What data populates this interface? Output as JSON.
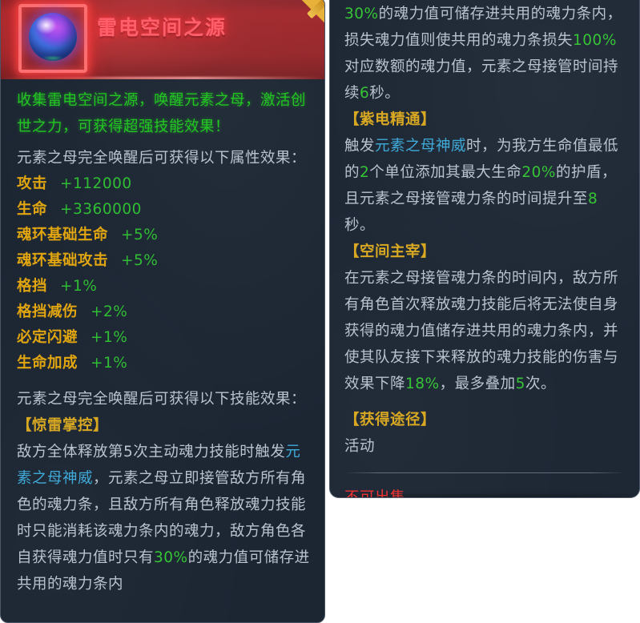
{
  "item": {
    "name": "雷电空间之源",
    "icon": "elemental-orb-icon",
    "rarity_color": "#ff5f6a",
    "frame_color": "#ff6f6f"
  },
  "left_panel": {
    "intro": "收集雷电空间之源，唤醒元素之母，激活创世之力，可获得超强技能效果！",
    "attribute_header": "元素之母完全唤醒后可获得以下属性效果：",
    "attributes": [
      {
        "label": "攻击",
        "value": "+112000"
      },
      {
        "label": "生命",
        "value": "+3360000"
      },
      {
        "label": "魂环基础生命",
        "value": "+5%"
      },
      {
        "label": "魂环基础攻击",
        "value": "+5%"
      },
      {
        "label": "格挡",
        "value": "+1%"
      },
      {
        "label": "格挡减伤",
        "value": "+2%"
      },
      {
        "label": "必定闪避",
        "value": "+1%"
      },
      {
        "label": "生命加成",
        "value": "+1%"
      }
    ],
    "skill_header": "元素之母完全唤醒后可获得以下技能效果：",
    "skill_1": {
      "title": "【惊雷掌控】",
      "parts": [
        {
          "text": "敌方全体释放第",
          "style": "grey"
        },
        {
          "text": "5",
          "style": "grey"
        },
        {
          "text": "次主动魂力技能时触发",
          "style": "grey"
        },
        {
          "text": "元素之母神威",
          "style": "blue"
        },
        {
          "text": "，元素之母立即接管敌方所有角色的魂力条，且敌方所有角色释放魂力技能时只能消耗该魂力条内的魂力，敌方角色各自获得魂力值时只有",
          "style": "grey"
        },
        {
          "text": "30%",
          "style": "green"
        },
        {
          "text": "的魂力值可储存进共用的魂力条内",
          "style": "grey"
        }
      ]
    }
  },
  "right_panel": {
    "skill_1_continued": {
      "parts": [
        {
          "text": "30%",
          "style": "green"
        },
        {
          "text": "的魂力值可储存进共用的魂力条内，损失魂力值则使共用的魂力条损失",
          "style": "grey"
        },
        {
          "text": "100%",
          "style": "green"
        },
        {
          "text": "对应数额的魂力值，元素之母接管时间持续",
          "style": "grey"
        },
        {
          "text": "6",
          "style": "green"
        },
        {
          "text": "秒。",
          "style": "grey"
        }
      ]
    },
    "skill_2": {
      "title": "【紫电精通】",
      "parts": [
        {
          "text": "触发",
          "style": "grey"
        },
        {
          "text": "元素之母神威",
          "style": "blue"
        },
        {
          "text": "时，为我方生命值最低的",
          "style": "grey"
        },
        {
          "text": "2",
          "style": "green"
        },
        {
          "text": "个单位添加其最大生命",
          "style": "grey"
        },
        {
          "text": "20%",
          "style": "green"
        },
        {
          "text": "的护盾，且元素之母接管魂力条的时间提升至",
          "style": "grey"
        },
        {
          "text": "8",
          "style": "green"
        },
        {
          "text": "秒。",
          "style": "grey"
        }
      ]
    },
    "skill_3": {
      "title": "【空间主宰】",
      "parts": [
        {
          "text": "在元素之母接管魂力条的时间内，敌方所有角色首次释放魂力技能后将无法使自身获得的魂力值储存进共用的魂力条内，并使其队友接下来释放的魂力技能的伤害与效果下降",
          "style": "grey"
        },
        {
          "text": "18%",
          "style": "green"
        },
        {
          "text": "，最多叠加",
          "style": "grey"
        },
        {
          "text": "5",
          "style": "green"
        },
        {
          "text": "次。",
          "style": "grey"
        }
      ]
    },
    "source": {
      "title": "【获得途径】",
      "value": "活动"
    },
    "sell_status": "不可出售"
  },
  "colors": {
    "green": "#22c522",
    "grey": "#b9c3ce",
    "gold": "#d8a822",
    "blue": "#3fa9d8",
    "red": "#f03232",
    "attr_label": "#e0a510",
    "attr_value": "#2fbe33",
    "panel_bg": "#1e2835",
    "header_bg": "#a32c31"
  }
}
